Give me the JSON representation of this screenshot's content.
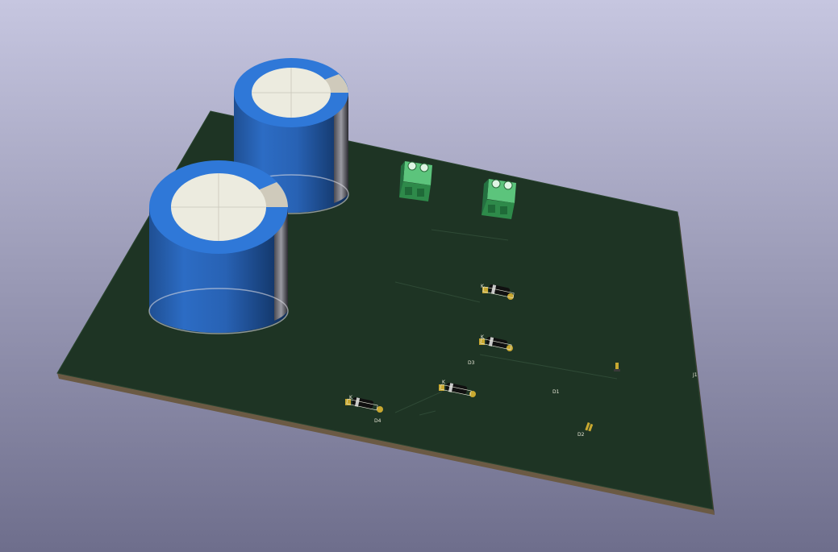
{
  "viewer": {
    "kind": "3D PCB viewer",
    "background_top": "#c6c6e0",
    "background_bottom": "#6e6e8c"
  },
  "board": {
    "soldermask_color": "#1e3424",
    "edge_color": "#6b5a44"
  },
  "capacitors": [
    {
      "id": "C1",
      "body_color": "#2f78d8",
      "top_color": "#ecebdf"
    },
    {
      "id": "C2",
      "body_color": "#2f78d8",
      "top_color": "#ecebdf"
    }
  ],
  "terminal_blocks": [
    {
      "id": "J1",
      "color": "#38a85c"
    },
    {
      "id": "J2",
      "color": "#38a85c"
    }
  ],
  "diodes": [
    {
      "id": "D1",
      "ref_label": "D1",
      "pin_label": "K"
    },
    {
      "id": "D2",
      "ref_label": "D2",
      "pin_label": "K"
    },
    {
      "id": "D3",
      "ref_label": "D3",
      "pin_label": "K"
    },
    {
      "id": "D4",
      "ref_label": "D4",
      "pin_label": "K"
    }
  ],
  "edge_label": "J1"
}
